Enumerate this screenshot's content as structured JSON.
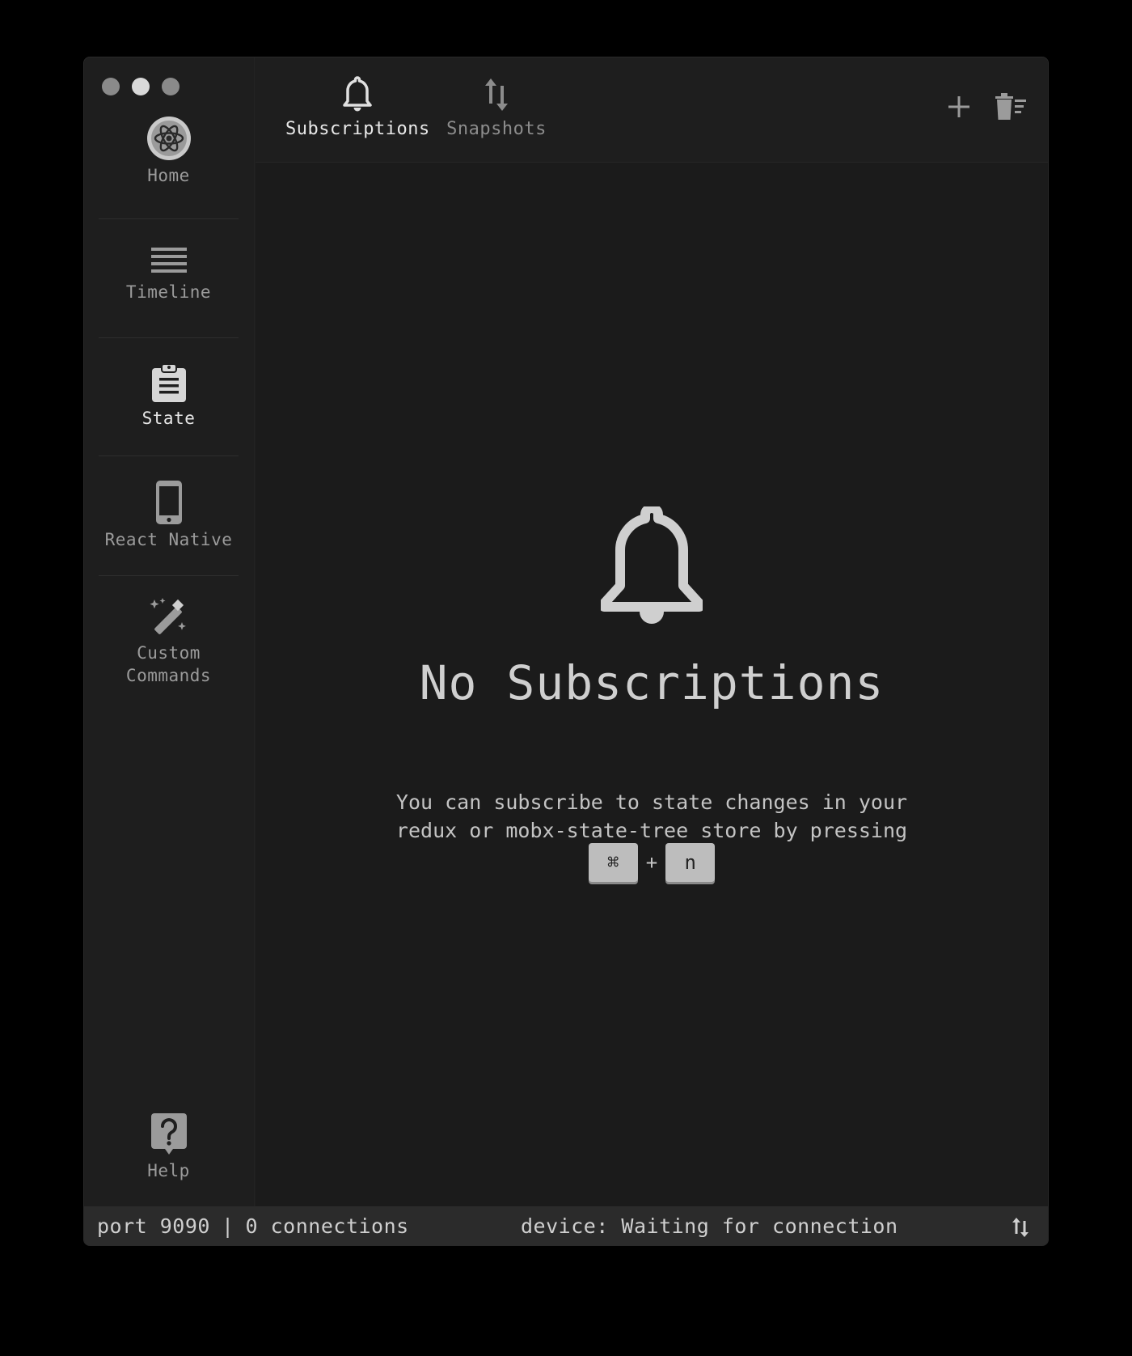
{
  "sidebar": {
    "items": [
      {
        "label": "Home",
        "icon": "reactotron-logo-icon"
      },
      {
        "label": "Timeline",
        "icon": "timeline-icon"
      },
      {
        "label": "State",
        "icon": "clipboard-icon"
      },
      {
        "label": "React Native",
        "icon": "phone-icon"
      },
      {
        "label": "Custom\nCommands",
        "icon": "magic-wand-icon"
      }
    ],
    "help_label": "Help"
  },
  "tabs": [
    {
      "label": "Subscriptions",
      "icon": "bell-icon",
      "active": true
    },
    {
      "label": "Snapshots",
      "icon": "swap-icon",
      "active": false
    }
  ],
  "empty_state": {
    "title": "No Subscriptions",
    "description": "You can subscribe to state changes in your redux or mobx-state-tree store by pressing",
    "key1": "⌘",
    "key_plus": "+",
    "key2": "n"
  },
  "status": {
    "port": "port 9090",
    "separator": "|",
    "connections": "0 connections",
    "device": "device: Waiting for connection"
  },
  "colors": {
    "window_bg": "#1e1e1e",
    "main_bg": "#1b1b1b",
    "statusbar_bg": "#2b2b2b",
    "key_bg": "#bdbdbd"
  }
}
